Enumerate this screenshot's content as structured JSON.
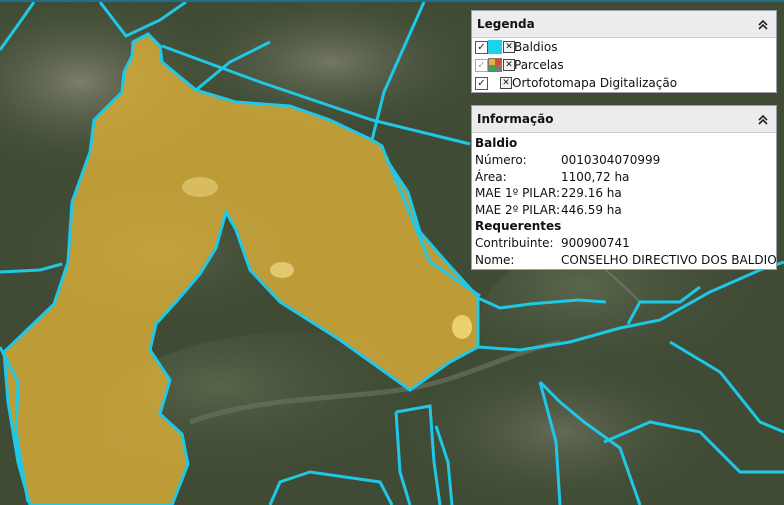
{
  "legend": {
    "title": "Legenda",
    "layers": [
      {
        "label": "Baldios",
        "checked": true,
        "enabled": true,
        "swatch": "baldios"
      },
      {
        "label": "Parcelas",
        "checked": true,
        "enabled": false,
        "swatch": "parcelas"
      },
      {
        "label": "Ortofotomapa Digitalização",
        "checked": true,
        "enabled": true,
        "swatch": "none"
      }
    ]
  },
  "info": {
    "title": "Informação",
    "baldio": {
      "heading": "Baldio",
      "numero_label": "Número:",
      "numero_value": "0010304070999",
      "area_label": "Área:",
      "area_value": "1100,72 ha",
      "mae1_label": "MAE 1º PILAR:",
      "mae1_value": "229.16 ha",
      "mae2_label": "MAE 2º PILAR:",
      "mae2_value": "446.59 ha"
    },
    "requerentes": {
      "heading": "Requerentes",
      "contribuinte_label": "Contribuinte:",
      "contribuinte_value": "900900741",
      "nome_label": "Nome:",
      "nome_value": "CONSELHO DIRECTIVO DOS BALDIOS"
    }
  },
  "icons": {
    "collapse": "double-chevron-up-icon",
    "remove": "close-icon",
    "checkbox": "checkmark-icon"
  },
  "colors": {
    "boundary": "#1ec8e6",
    "selected_fill": "#e0b33a",
    "swatch_baldios": "#1ed2ee"
  }
}
